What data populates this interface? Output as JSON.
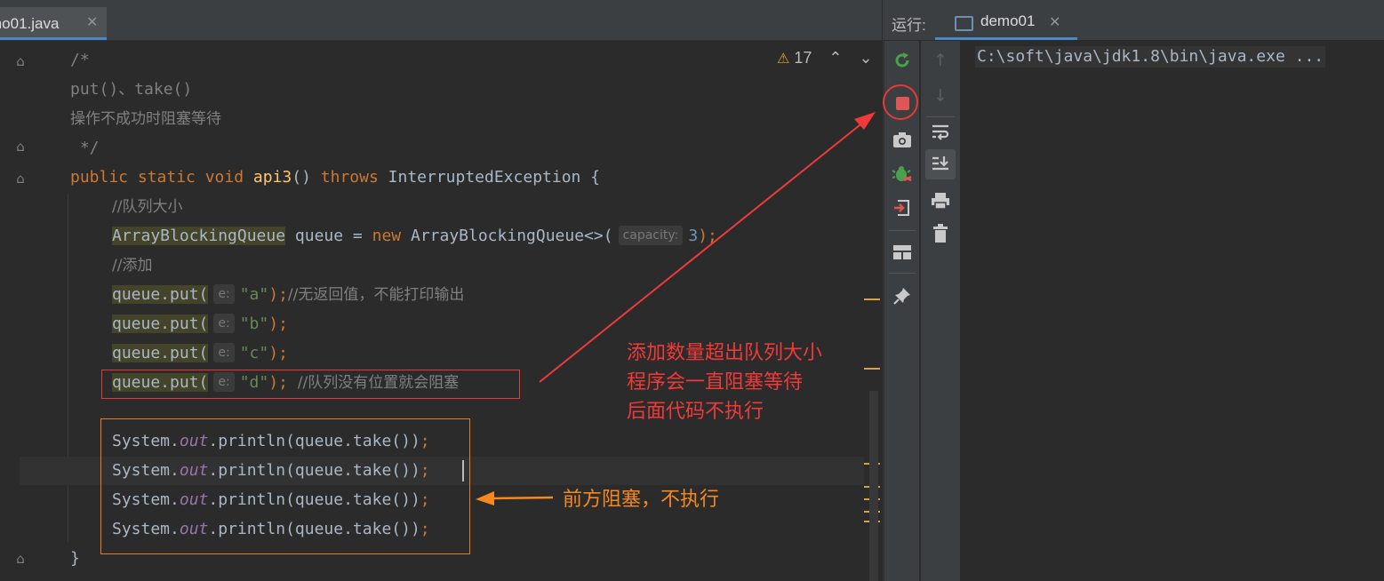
{
  "editor": {
    "tab": {
      "label": "mo01.java",
      "close": "✕"
    },
    "warnings": {
      "icon": "⚠",
      "count": "17",
      "prev": "⌃",
      "next": "⌄"
    },
    "lines": {
      "l1": "/*",
      "l2": "put()、take()",
      "l3": "操作不成功时阻塞等待",
      "l4": " */",
      "l5_kw": "public static void ",
      "l5_fn": "api3",
      "l5_mid": "() ",
      "l5_throws": "throws ",
      "l5_rest": "InterruptedException {",
      "l6": "//队列大小",
      "l7_type": "ArrayBlockingQueue",
      "l7_mid": " queue = ",
      "l7_new": "new ",
      "l7_ctor": "ArrayBlockingQueue<>(",
      "l7_hint": "capacity:",
      "l7_num": "3",
      "l7_end": ");",
      "l8": "//添加",
      "put_prefix": "queue.put(",
      "put_hint": "e:",
      "put_a": "\"a\"",
      "put_a_end": ");",
      "put_a_cmt": "//无返回值，不能打印输出",
      "put_b": "\"b\"",
      "put_c": "\"c\"",
      "put_d": "\"d\"",
      "put_end": ");",
      "put_d_cmt": "//队列没有位置就会阻塞",
      "sys": "System.",
      "out": "out",
      "println": ".println(queue.take())",
      "semi": ";",
      "close_brace": "}"
    }
  },
  "annotations": {
    "red_note": [
      "添加数量超出队列大小",
      "程序会一直阻塞等待",
      "后面代码不执行"
    ],
    "orange_note": "前方阻塞，不执行"
  },
  "run_panel": {
    "label": "运行:",
    "tab_label": "demo01",
    "tab_close": "✕",
    "console_output": "C:\\soft\\java\\jdk1.8\\bin\\java.exe ..."
  },
  "colors": {
    "keyword": "#cc7832",
    "function": "#ffc66d",
    "string": "#6a8759",
    "number": "#6897bb",
    "comment": "#808080",
    "annotation_red": "#f03a3a",
    "annotation_orange": "#f5891f"
  }
}
